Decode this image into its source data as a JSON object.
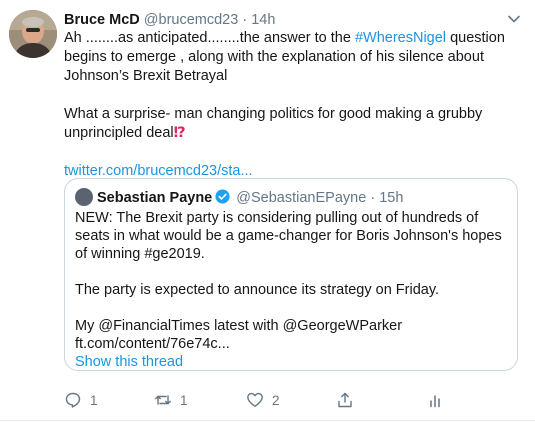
{
  "tweet": {
    "author_name": "Bruce McD",
    "author_handle": "@brucemcd23",
    "separator": "·",
    "time": "14h",
    "text": {
      "p1_a": "Ah ........as anticipated........the answer to the ",
      "p1_hashtag": "#WheresNigel",
      "p1_b": " question begins to emerge , along with the explanation of his silence about Johnson’s Brexit Betrayal",
      "p2": "What a surprise- man changing politics for good making a grubby unprincipled deal",
      "p2_emoji": "⁉",
      "link": "twitter.com/brucemcd23/sta..."
    }
  },
  "quoted": {
    "author_name": "Sebastian Payne",
    "author_handle": "@SebastianEPayne",
    "separator": "·",
    "time": "15h",
    "p1": "NEW: The Brexit party is considering pulling out of hundreds of seats in what would be a game-changer for Boris Johnson's hopes of winning #ge2019.",
    "p2": "The party is expected to  announce its strategy on Friday.",
    "p3_line1": "My @FinancialTimes latest with @GeorgeWParker",
    "p3_line2": "ft.com/content/76e74c...",
    "show_thread": "Show this thread"
  },
  "actions": {
    "reply_count": "1",
    "retweet_count": "1",
    "like_count": "2"
  },
  "icons": {
    "caret": "chevron-down-icon",
    "reply": "reply-icon",
    "retweet": "retweet-icon",
    "like": "heart-icon",
    "share": "share-icon",
    "analytics": "analytics-icon",
    "verified": "verified-badge-icon"
  },
  "colors": {
    "link": "#1b95e0",
    "secondary_text": "#657786",
    "border": "#ccd6dd",
    "verified": "#1da1f2"
  }
}
